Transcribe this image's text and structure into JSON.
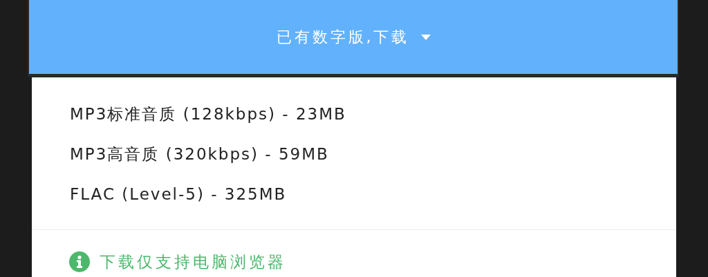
{
  "button": {
    "label": "已有数字版,下载",
    "expanded": true
  },
  "menu": {
    "items": [
      {
        "label": "MP3标准音质 (128kbps) - 23MB"
      },
      {
        "label": "MP3高音质 (320kbps) - 59MB"
      },
      {
        "label": "FLAC (Level-5) - 325MB"
      }
    ],
    "note": "下载仅支持电脑浏览器"
  }
}
